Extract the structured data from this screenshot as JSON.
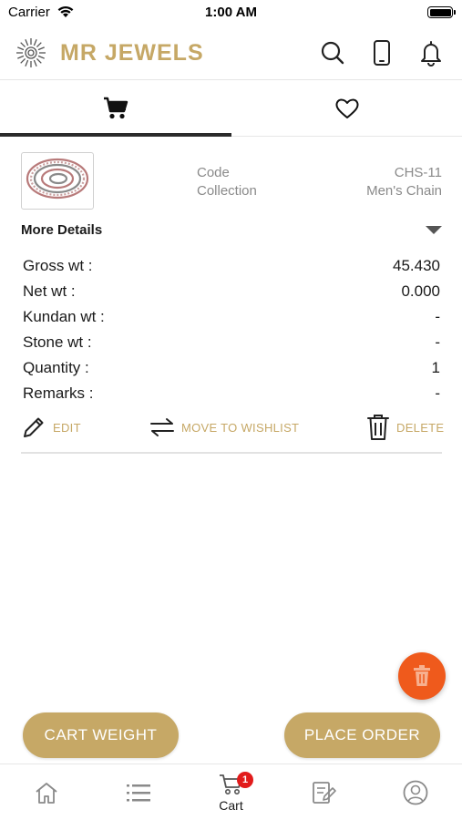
{
  "status_bar": {
    "carrier": "Carrier",
    "time": "1:00 AM"
  },
  "header": {
    "brand": "MR JEWELS"
  },
  "tabs": [
    {
      "icon": "cart-icon",
      "selected": true
    },
    {
      "icon": "heart-icon",
      "selected": false
    }
  ],
  "item": {
    "code_label": "Code",
    "code_value": "CHS-11",
    "collection_label": "Collection",
    "collection_value": "Men's Chain",
    "more_details_label": "More Details",
    "details": [
      {
        "label": "Gross wt :",
        "value": "45.430"
      },
      {
        "label": "Net wt :",
        "value": "0.000"
      },
      {
        "label": "Kundan wt :",
        "value": "-"
      },
      {
        "label": "Stone wt :",
        "value": "-"
      },
      {
        "label": "Quantity :",
        "value": "1"
      },
      {
        "label": "Remarks :",
        "value": "-"
      }
    ],
    "actions": {
      "edit": "EDIT",
      "move": "MOVE TO WISHLIST",
      "delete": "DELETE"
    }
  },
  "buttons": {
    "cart_weight": "CART WEIGHT",
    "place_order": "PLACE ORDER"
  },
  "tabbar": {
    "cart_label": "Cart",
    "cart_badge": "1"
  },
  "colors": {
    "accent_gold": "#c6a866",
    "fab_orange": "#ef5a1c",
    "badge_red": "#e21b1b"
  }
}
